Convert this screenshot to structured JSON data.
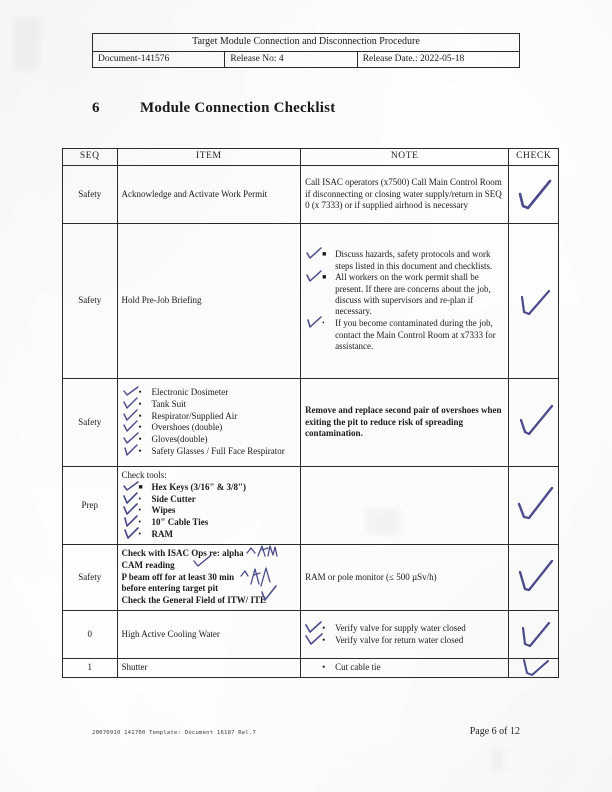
{
  "document_header": {
    "title": "Target Module Connection and Disconnection Procedure",
    "document_no": "Document-141576",
    "release_no": "Release No: 4",
    "release_date": "Release Date.: 2022-05-18"
  },
  "section": {
    "number": "6",
    "title": "Module Connection Checklist"
  },
  "table": {
    "columns": [
      "SEQ",
      "ITEM",
      "NOTE",
      "CHECK"
    ],
    "rows": [
      {
        "seq": "Safety",
        "item_text": "Acknowledge and Activate Work Permit",
        "note_text": "Call ISAC operators (x7500) Call Main Control Room if disconnecting or closing water supply/return in SEQ 0 (x 7333) or if supplied airhood is necessary",
        "checked": true
      },
      {
        "seq": "Safety",
        "item_text": "Hold Pre-Job Briefing",
        "note_bullets": [
          "Discuss hazards, safety protocols and work steps listed in this document and checklists.",
          "All workers on the work permit shall be present. If there are concerns about the job, discuss with supervisors and re-plan if necessary.",
          "If you become contaminated during the job, contact the Main Control Room at x7333 for assistance."
        ],
        "checked": true
      },
      {
        "seq": "Safety",
        "item_bullets": [
          "Electronic Dosimeter",
          "Tank Suit",
          "Respirator/Supplied Air",
          "Overshoes (double)",
          "Gloves(double)",
          "Safety Glasses / Full Face Respirator"
        ],
        "note_text": "Remove and replace second pair of overshoes when exiting the pit to reduce risk of spreading contamination.",
        "checked": true
      },
      {
        "seq": "Prep",
        "item_heading": "Check tools:",
        "item_bullets": [
          "Hex Keys (3/16\" & 3/8\")",
          "Side Cutter",
          "Wipes",
          "10\" Cable Ties",
          "RAM"
        ],
        "note_text": "",
        "checked": true
      },
      {
        "seq": "Safety",
        "item_lines": [
          "Check with ISAC Ops re: alpha",
          "CAM reading",
          "P beam off for at least 30 min",
          "before entering target pit",
          "Check the General Field of ITW/ ITE"
        ],
        "note_text": "RAM or pole monitor (≤ 500 µSv/h)",
        "checked": true
      },
      {
        "seq": "0",
        "item_text": "High Active Cooling Water",
        "note_bullets": [
          "Verify valve for supply water closed",
          "Verify valve for return water closed"
        ],
        "checked": true
      },
      {
        "seq": "1",
        "item_text": "Shutter",
        "note_bullets": [
          "Cut cable tie"
        ],
        "checked": true
      }
    ]
  },
  "footer": {
    "left": "20070910 141700 Template: Document 16187 Rel.7",
    "right": "Page 6 of 12"
  },
  "ink": {
    "check_color": "#4a4a8c"
  }
}
